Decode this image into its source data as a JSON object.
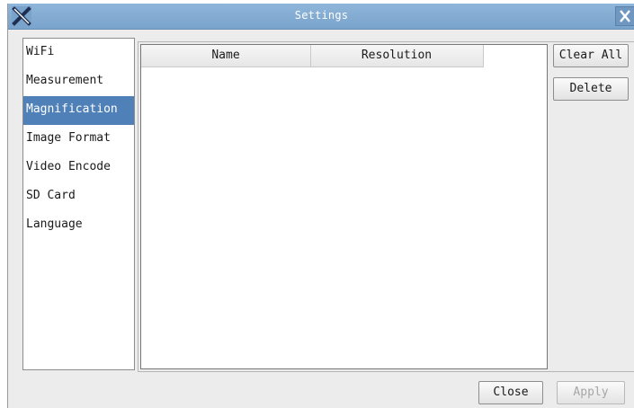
{
  "window": {
    "title": "Settings",
    "logo_icon": "app-x-logo-icon",
    "close_icon": "close-icon"
  },
  "sidebar": {
    "items": [
      {
        "label": "WiFi",
        "selected": false
      },
      {
        "label": "Measurement",
        "selected": false
      },
      {
        "label": "Magnification",
        "selected": true
      },
      {
        "label": "Image Format",
        "selected": false
      },
      {
        "label": "Video Encode",
        "selected": false
      },
      {
        "label": "SD Card",
        "selected": false
      },
      {
        "label": "Language",
        "selected": false
      }
    ]
  },
  "table": {
    "columns": [
      "Name",
      "Resolution"
    ],
    "rows": []
  },
  "buttons": {
    "clear_all": "Clear All",
    "delete": "Delete",
    "close": "Close",
    "apply": "Apply"
  },
  "colors": {
    "titlebar": "#7aa3cc",
    "selection": "#4f80b7",
    "disabled_text": "#a6a6a6"
  }
}
